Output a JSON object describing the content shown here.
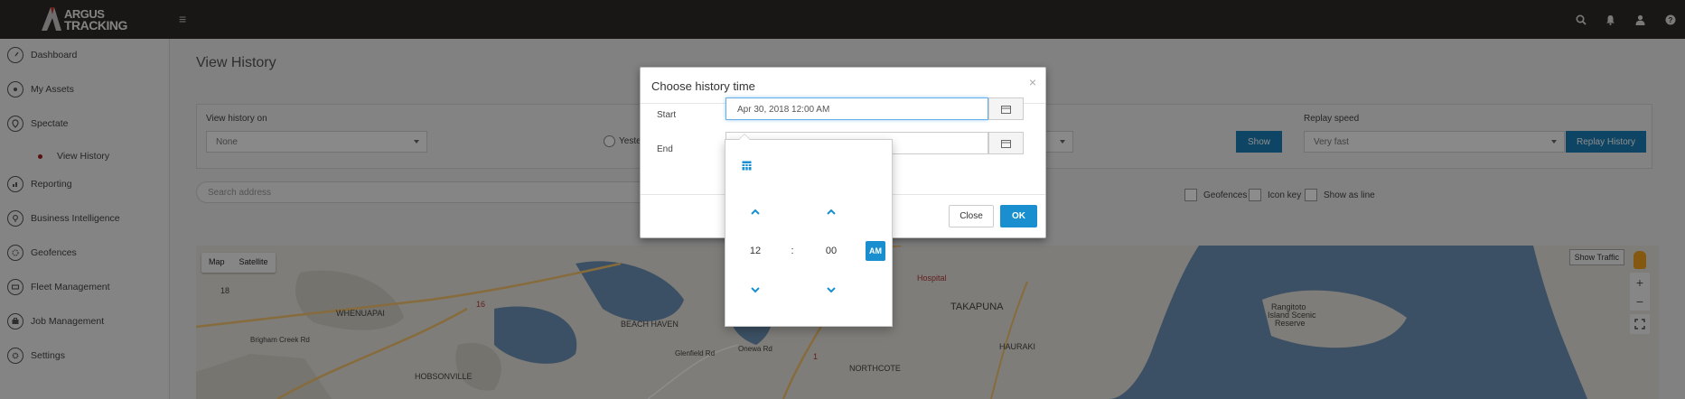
{
  "app": {
    "logo_line1": "ARGUS",
    "logo_line2": "TRACKING"
  },
  "topbar_icons": [
    "search-icon",
    "bell-icon",
    "user-icon",
    "help-icon"
  ],
  "sidebar": {
    "items": [
      {
        "label": "Dashboard",
        "icon": "dashboard-icon"
      },
      {
        "label": "My Assets",
        "icon": "assets-icon"
      },
      {
        "label": "Spectate",
        "icon": "location-pin-icon"
      },
      {
        "label": "View History",
        "sub": true
      },
      {
        "label": "Reporting",
        "icon": "reporting-icon"
      },
      {
        "label": "Business Intelligence",
        "icon": "bulb-icon"
      },
      {
        "label": "Geofences",
        "icon": "geofence-icon"
      },
      {
        "label": "Fleet Management",
        "icon": "fleet-icon"
      },
      {
        "label": "Job Management",
        "icon": "job-icon"
      },
      {
        "label": "Settings",
        "icon": "gear-icon"
      }
    ],
    "active_color": "#a01d1d"
  },
  "main": {
    "title": "View History",
    "view_history_on_label": "View history on",
    "view_history_on_value": "None",
    "radio_label_partial": "Yeste",
    "show_button": "Show",
    "replay_speed_label": "Replay speed",
    "replay_speed_value": "Very fast",
    "replay_button": "Replay History",
    "search_placeholder": "Search address",
    "checkboxes": [
      "Geofences",
      "Icon key",
      "Show as line"
    ]
  },
  "map": {
    "type_buttons": [
      "Map",
      "Satellite"
    ],
    "show_traffic": "Show Traffic",
    "zoom_in": "+",
    "zoom_out": "−",
    "labels": [
      "WHENUAPAI",
      "HOBSONVILLE",
      "BEACH HAVEN",
      "TAKAPUNA",
      "HAURAKI",
      "NORTHCOTE",
      "Rangitoto",
      "Island Scenic",
      "Reserve",
      "Hospital",
      "18",
      "16",
      "1",
      "Brigham Creek Rd",
      "Glenfield Rd",
      "Onewa Rd"
    ],
    "water_color": "#6c92b6",
    "land_color": "#e8e4dc"
  },
  "modal": {
    "title": "Choose history time",
    "close_glyph": "×",
    "start_label": "Start",
    "start_value": "Apr 30, 2018 12:00 AM",
    "end_label": "End",
    "close_button": "Close",
    "ok_button": "OK"
  },
  "time_picker": {
    "hour": "12",
    "separator": ":",
    "minute": "00",
    "ampm": "AM"
  },
  "colors": {
    "accent": "#1a8fd0",
    "topbar": "#2e2a28"
  }
}
